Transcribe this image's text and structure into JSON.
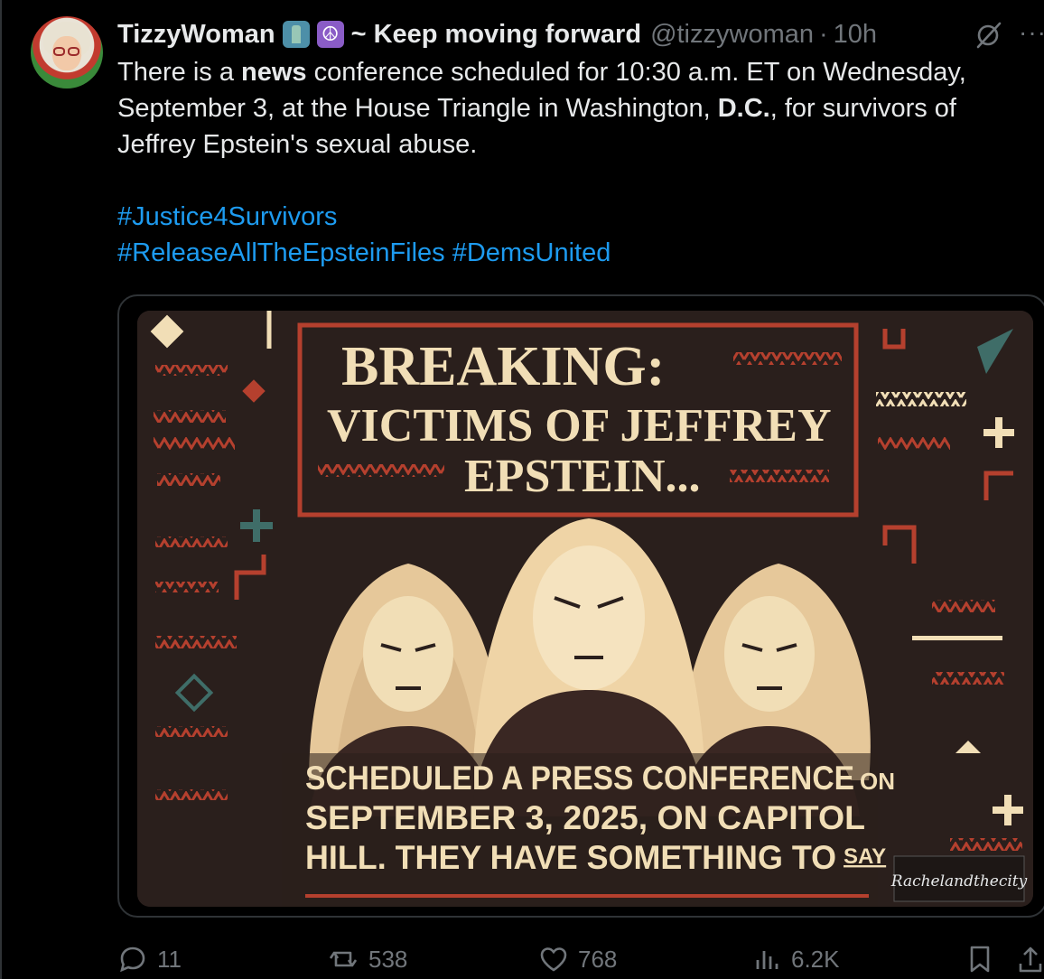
{
  "tweet": {
    "author_name": "TizzyWoman",
    "author_tagline": "~ Keep moving forward",
    "handle": "@tizzywoman",
    "separator": "·",
    "time": "10h",
    "more": "···",
    "text_parts": {
      "p1": "There is a ",
      "b1": "news",
      "p2": " conference scheduled for 10:30 a.m. ET on Wednesday, September 3, at the House Triangle in Washington, ",
      "b2": "D.C.",
      "p3": ", for survivors of Jeffrey Epstein's sexual abuse."
    },
    "hashtags": [
      "#Justice4Survivors",
      "#ReleaseAllTheEpsteinFiles",
      "#DemsUnited"
    ]
  },
  "poster": {
    "headline_1": "BREAKING:",
    "headline_2": "VICTIMS OF JEFFREY",
    "headline_3": "EPSTEIN...",
    "body_1a": "SCHEDULED A PRESS CONFERENCE",
    "body_1b": "ON",
    "body_2": "SEPTEMBER 3, 2025, ON CAPITOL",
    "body_3a": "HILL. THEY HAVE SOMETHING TO",
    "body_3b": "SAY",
    "signature": "Rachelandthecity",
    "colors": {
      "background": "#2a1f1c",
      "cream": "#f1deb6",
      "red": "#b5402e",
      "teal": "#3f6d68"
    }
  },
  "actions": {
    "replies": "11",
    "reposts": "538",
    "likes": "768",
    "views": "6.2K"
  },
  "icons": [
    "grok-icon",
    "more-icon",
    "reply-icon",
    "repost-icon",
    "like-icon",
    "views-icon",
    "bookmark-icon",
    "share-icon"
  ]
}
